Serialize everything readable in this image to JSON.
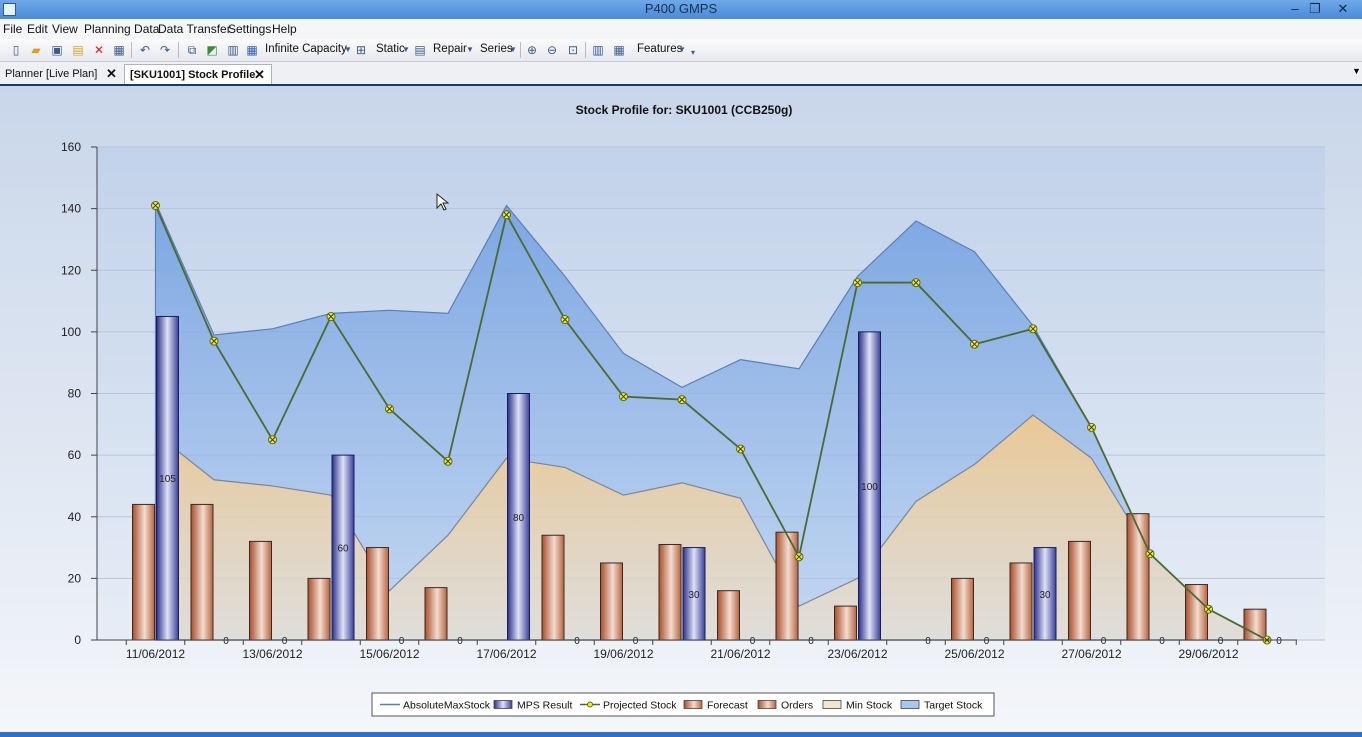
{
  "window": {
    "title": "P400 GMPS"
  },
  "menu": [
    "File",
    "Edit",
    "View",
    "Planning Data",
    "Data Transfer",
    "Settings",
    "Help"
  ],
  "toolbar": {
    "infinite_capacity": "Infinite Capacity",
    "static": "Static",
    "repair": "Repair",
    "series": "Series",
    "features": "Features"
  },
  "tabs": [
    {
      "label": "Planner [Live Plan]",
      "active": false
    },
    {
      "label": "[SKU1001] Stock Profile",
      "active": true
    }
  ],
  "chart_data": {
    "type": "bar",
    "title": "Stock Profile for: SKU1001 (CCB250g)",
    "ylim": [
      0,
      160
    ],
    "yticks": [
      "0",
      "20",
      "40",
      "60",
      "80",
      "100",
      "120",
      "140",
      "160"
    ],
    "xtick_labels": [
      "11/06/2012",
      "13/06/2012",
      "15/06/2012",
      "17/06/2012",
      "19/06/2012",
      "21/06/2012",
      "23/06/2012",
      "25/06/2012",
      "27/06/2012",
      "29/06/2012"
    ],
    "grid": true,
    "legend_position": "bottom",
    "colors": {
      "absolute_max": "#7fa8df",
      "target": "#8fb3e4",
      "min": "#f0d3a6",
      "projected": "#4a6a33",
      "mps": "#3a3f9a",
      "forecast": "#b7643f",
      "orders": "#b7643f"
    },
    "x_days": [
      11,
      12,
      13,
      14,
      15,
      16,
      17,
      18,
      19,
      20,
      21,
      22,
      23,
      24,
      25,
      26,
      27,
      28,
      29,
      30
    ],
    "series": [
      {
        "name": "AbsoluteMaxStock",
        "kind": "area",
        "values": [
          142,
          99,
          101,
          106,
          107,
          106,
          141,
          118,
          93,
          82,
          91,
          88,
          118,
          136,
          126,
          102,
          69,
          28,
          10,
          0
        ]
      },
      {
        "name": "Min Stock",
        "kind": "area",
        "values": [
          67,
          52,
          50,
          47,
          16,
          34,
          59,
          56,
          47,
          51,
          46,
          11,
          20,
          45,
          57,
          73,
          59,
          28,
          10,
          0
        ]
      },
      {
        "name": "Projected Stock",
        "kind": "line",
        "values": [
          141,
          97,
          65,
          105,
          75,
          58,
          138,
          104,
          79,
          78,
          62,
          27,
          116,
          116,
          96,
          101,
          69,
          28,
          10,
          0
        ]
      },
      {
        "name": "Forecast",
        "kind": "bar",
        "values": [
          44,
          44,
          32,
          20,
          30,
          17,
          null,
          34,
          25,
          31,
          16,
          35,
          11,
          null,
          20,
          25,
          32,
          41,
          18,
          10
        ]
      },
      {
        "name": "MPS Result",
        "kind": "bar",
        "values": [
          105,
          0,
          0,
          60,
          0,
          0,
          80,
          0,
          0,
          30,
          0,
          0,
          100,
          0,
          0,
          30,
          0,
          0,
          0,
          0
        ],
        "labels": [
          "105",
          "0",
          "0",
          "60",
          "0",
          "0",
          "80",
          "0",
          "0",
          "30",
          "0",
          "0",
          "100",
          "0",
          "0",
          "30",
          "0",
          "0",
          "0",
          "0"
        ]
      }
    ],
    "legend": [
      "AbsoluteMaxStock",
      "MPS Result",
      "Projected Stock",
      "Forecast",
      "Orders",
      "Min Stock",
      "Target Stock"
    ]
  }
}
